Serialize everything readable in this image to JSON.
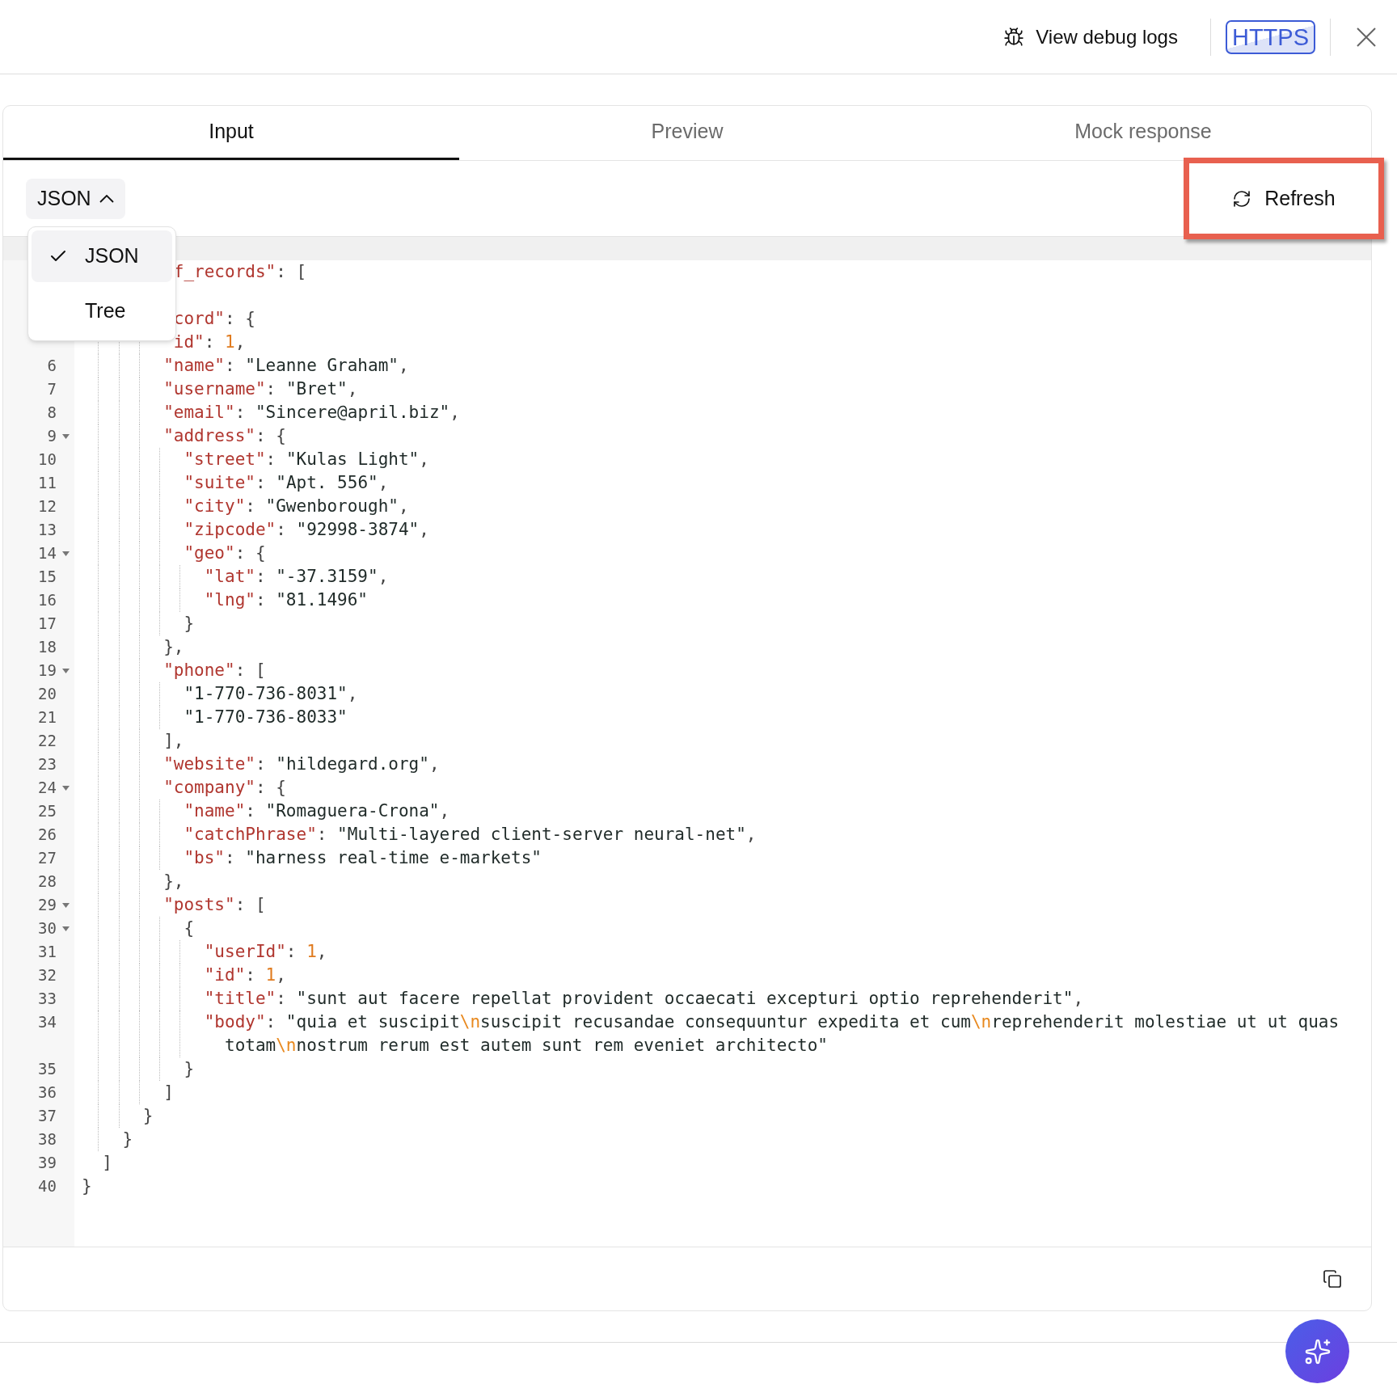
{
  "header": {
    "debug_logs_link": "View debug logs",
    "protocol_badge": "HTTPS"
  },
  "tabs": [
    {
      "label": "Input",
      "selected": true
    },
    {
      "label": "Preview",
      "selected": false
    },
    {
      "label": "Mock response",
      "selected": false
    }
  ],
  "format_select": {
    "value": "JSON",
    "expanded": true,
    "options": [
      {
        "label": "JSON",
        "selected": true
      },
      {
        "label": "Tree",
        "selected": false
      }
    ]
  },
  "refresh_button": {
    "label": "Refresh",
    "annotated": true
  },
  "code_lines": [
    {
      "active": true
    },
    {
      "active": false,
      "tokens": [
        {
          "kind": "key",
          "text": "         f_records\""
        },
        {
          "kind": "punct",
          "text": ": ["
        }
      ]
    },
    {
      "active": false
    },
    {
      "active": false,
      "tokens": [
        {
          "kind": "key",
          "text": "         cord\""
        },
        {
          "kind": "punct",
          "text": ": {"
        }
      ]
    },
    {
      "active": false,
      "tokens": [
        {
          "kind": "key",
          "text": "         id\""
        },
        {
          "kind": "punct",
          "text": ": "
        },
        {
          "kind": "number",
          "text": "1"
        },
        {
          "kind": "punct",
          "text": ","
        }
      ]
    },
    {
      "number": "6",
      "foldable": false,
      "active": false,
      "tokens": [
        {
          "kind": "key",
          "text": "        \"name\""
        },
        {
          "kind": "punct",
          "text": ": "
        },
        {
          "kind": "string",
          "text": "\"Leanne Graham\""
        },
        {
          "kind": "punct",
          "text": ","
        }
      ]
    },
    {
      "number": "7",
      "foldable": false,
      "active": false,
      "tokens": [
        {
          "kind": "key",
          "text": "        \"username\""
        },
        {
          "kind": "punct",
          "text": ": "
        },
        {
          "kind": "string",
          "text": "\"Bret\""
        },
        {
          "kind": "punct",
          "text": ","
        }
      ]
    },
    {
      "number": "8",
      "foldable": false,
      "active": false,
      "tokens": [
        {
          "kind": "key",
          "text": "        \"email\""
        },
        {
          "kind": "punct",
          "text": ": "
        },
        {
          "kind": "string",
          "text": "\"Sincere@april.biz\""
        },
        {
          "kind": "punct",
          "text": ","
        }
      ]
    },
    {
      "number": "9",
      "foldable": true,
      "active": false,
      "tokens": [
        {
          "kind": "key",
          "text": "        \"address\""
        },
        {
          "kind": "punct",
          "text": ": {"
        }
      ]
    },
    {
      "number": "10",
      "foldable": false,
      "active": false,
      "tokens": [
        {
          "kind": "key",
          "text": "          \"street\""
        },
        {
          "kind": "punct",
          "text": ": "
        },
        {
          "kind": "string",
          "text": "\"Kulas Light\""
        },
        {
          "kind": "punct",
          "text": ","
        }
      ]
    },
    {
      "number": "11",
      "foldable": false,
      "active": false,
      "tokens": [
        {
          "kind": "key",
          "text": "          \"suite\""
        },
        {
          "kind": "punct",
          "text": ": "
        },
        {
          "kind": "string",
          "text": "\"Apt. 556\""
        },
        {
          "kind": "punct",
          "text": ","
        }
      ]
    },
    {
      "number": "12",
      "foldable": false,
      "active": false,
      "tokens": [
        {
          "kind": "key",
          "text": "          \"city\""
        },
        {
          "kind": "punct",
          "text": ": "
        },
        {
          "kind": "string",
          "text": "\"Gwenborough\""
        },
        {
          "kind": "punct",
          "text": ","
        }
      ]
    },
    {
      "number": "13",
      "foldable": false,
      "active": false,
      "tokens": [
        {
          "kind": "key",
          "text": "          \"zipcode\""
        },
        {
          "kind": "punct",
          "text": ": "
        },
        {
          "kind": "string",
          "text": "\"92998-3874\""
        },
        {
          "kind": "punct",
          "text": ","
        }
      ]
    },
    {
      "number": "14",
      "foldable": true,
      "active": false,
      "tokens": [
        {
          "kind": "key",
          "text": "          \"geo\""
        },
        {
          "kind": "punct",
          "text": ": {"
        }
      ]
    },
    {
      "number": "15",
      "foldable": false,
      "active": false,
      "tokens": [
        {
          "kind": "key",
          "text": "            \"lat\""
        },
        {
          "kind": "punct",
          "text": ": "
        },
        {
          "kind": "string",
          "text": "\"-37.3159\""
        },
        {
          "kind": "punct",
          "text": ","
        }
      ]
    },
    {
      "number": "16",
      "foldable": false,
      "active": false,
      "tokens": [
        {
          "kind": "key",
          "text": "            \"lng\""
        },
        {
          "kind": "punct",
          "text": ": "
        },
        {
          "kind": "string",
          "text": "\"81.1496\""
        }
      ]
    },
    {
      "number": "17",
      "foldable": false,
      "active": false,
      "tokens": [
        {
          "kind": "punct",
          "text": "          }"
        }
      ]
    },
    {
      "number": "18",
      "foldable": false,
      "active": false,
      "tokens": [
        {
          "kind": "punct",
          "text": "        },"
        }
      ]
    },
    {
      "number": "19",
      "foldable": true,
      "active": false,
      "tokens": [
        {
          "kind": "key",
          "text": "        \"phone\""
        },
        {
          "kind": "punct",
          "text": ": ["
        }
      ]
    },
    {
      "number": "20",
      "foldable": false,
      "active": false,
      "tokens": [
        {
          "kind": "string",
          "text": "          \"1-770-736-8031\""
        },
        {
          "kind": "punct",
          "text": ","
        }
      ]
    },
    {
      "number": "21",
      "foldable": false,
      "active": false,
      "tokens": [
        {
          "kind": "string",
          "text": "          \"1-770-736-8033\""
        }
      ]
    },
    {
      "number": "22",
      "foldable": false,
      "active": false,
      "tokens": [
        {
          "kind": "punct",
          "text": "        ],"
        }
      ]
    },
    {
      "number": "23",
      "foldable": false,
      "active": false,
      "tokens": [
        {
          "kind": "key",
          "text": "        \"website\""
        },
        {
          "kind": "punct",
          "text": ": "
        },
        {
          "kind": "string",
          "text": "\"hildegard.org\""
        },
        {
          "kind": "punct",
          "text": ","
        }
      ]
    },
    {
      "number": "24",
      "foldable": true,
      "active": false,
      "tokens": [
        {
          "kind": "key",
          "text": "        \"company\""
        },
        {
          "kind": "punct",
          "text": ": {"
        }
      ]
    },
    {
      "number": "25",
      "foldable": false,
      "active": false,
      "tokens": [
        {
          "kind": "key",
          "text": "          \"name\""
        },
        {
          "kind": "punct",
          "text": ": "
        },
        {
          "kind": "string",
          "text": "\"Romaguera-Crona\""
        },
        {
          "kind": "punct",
          "text": ","
        }
      ]
    },
    {
      "number": "26",
      "foldable": false,
      "active": false,
      "tokens": [
        {
          "kind": "key",
          "text": "          \"catchPhrase\""
        },
        {
          "kind": "punct",
          "text": ": "
        },
        {
          "kind": "string",
          "text": "\"Multi-layered client-server neural-net\""
        },
        {
          "kind": "punct",
          "text": ","
        }
      ]
    },
    {
      "number": "27",
      "foldable": false,
      "active": false,
      "tokens": [
        {
          "kind": "key",
          "text": "          \"bs\""
        },
        {
          "kind": "punct",
          "text": ": "
        },
        {
          "kind": "string",
          "text": "\"harness real-time e-markets\""
        }
      ]
    },
    {
      "number": "28",
      "foldable": false,
      "active": false,
      "tokens": [
        {
          "kind": "punct",
          "text": "        },"
        }
      ]
    },
    {
      "number": "29",
      "foldable": true,
      "active": false,
      "tokens": [
        {
          "kind": "key",
          "text": "        \"posts\""
        },
        {
          "kind": "punct",
          "text": ": ["
        }
      ]
    },
    {
      "number": "30",
      "foldable": true,
      "active": false,
      "tokens": [
        {
          "kind": "punct",
          "text": "          {"
        }
      ]
    },
    {
      "number": "31",
      "foldable": false,
      "active": false,
      "tokens": [
        {
          "kind": "key",
          "text": "            \"userId\""
        },
        {
          "kind": "punct",
          "text": ": "
        },
        {
          "kind": "number",
          "text": "1"
        },
        {
          "kind": "punct",
          "text": ","
        }
      ]
    },
    {
      "number": "32",
      "foldable": false,
      "active": false,
      "tokens": [
        {
          "kind": "key",
          "text": "            \"id\""
        },
        {
          "kind": "punct",
          "text": ": "
        },
        {
          "kind": "number",
          "text": "1"
        },
        {
          "kind": "punct",
          "text": ","
        }
      ]
    },
    {
      "number": "33",
      "foldable": false,
      "active": false,
      "tokens": [
        {
          "kind": "key",
          "text": "            \"title\""
        },
        {
          "kind": "punct",
          "text": ": "
        },
        {
          "kind": "string",
          "text": "\"sunt aut facere repellat provident occaecati excepturi optio reprehenderit\""
        },
        {
          "kind": "punct",
          "text": ","
        }
      ]
    },
    {
      "number": "34",
      "foldable": false,
      "active": false,
      "tokens": [
        {
          "kind": "key",
          "text": "            \"body\""
        },
        {
          "kind": "punct",
          "text": ": "
        },
        {
          "kind": "string",
          "text": "\"quia et suscipit"
        },
        {
          "kind": "escape",
          "text": "\\n"
        },
        {
          "kind": "string",
          "text": "suscipit recusandae consequuntur expedita et cum"
        },
        {
          "kind": "escape",
          "text": "\\n"
        },
        {
          "kind": "string",
          "text": "reprehenderit molestiae ut ut quas totam"
        },
        {
          "kind": "escape",
          "text": "\\n"
        },
        {
          "kind": "string",
          "text": "nostrum rerum est autem sunt rem eveniet architecto\""
        }
      ]
    },
    {
      "number": "35",
      "foldable": false,
      "active": false,
      "tokens": [
        {
          "kind": "punct",
          "text": "          }"
        }
      ]
    },
    {
      "number": "36",
      "foldable": false,
      "active": false,
      "tokens": [
        {
          "kind": "punct",
          "text": "        ]"
        }
      ]
    },
    {
      "number": "37",
      "foldable": false,
      "active": false,
      "tokens": [
        {
          "kind": "punct",
          "text": "      }"
        }
      ]
    },
    {
      "number": "38",
      "foldable": false,
      "active": false,
      "tokens": [
        {
          "kind": "punct",
          "text": "    }"
        }
      ]
    },
    {
      "number": "39",
      "foldable": false,
      "active": false,
      "tokens": [
        {
          "kind": "punct",
          "text": "  ]"
        }
      ]
    },
    {
      "number": "40",
      "foldable": false,
      "active": false,
      "tokens": [
        {
          "kind": "punct",
          "text": "}"
        }
      ]
    }
  ]
}
